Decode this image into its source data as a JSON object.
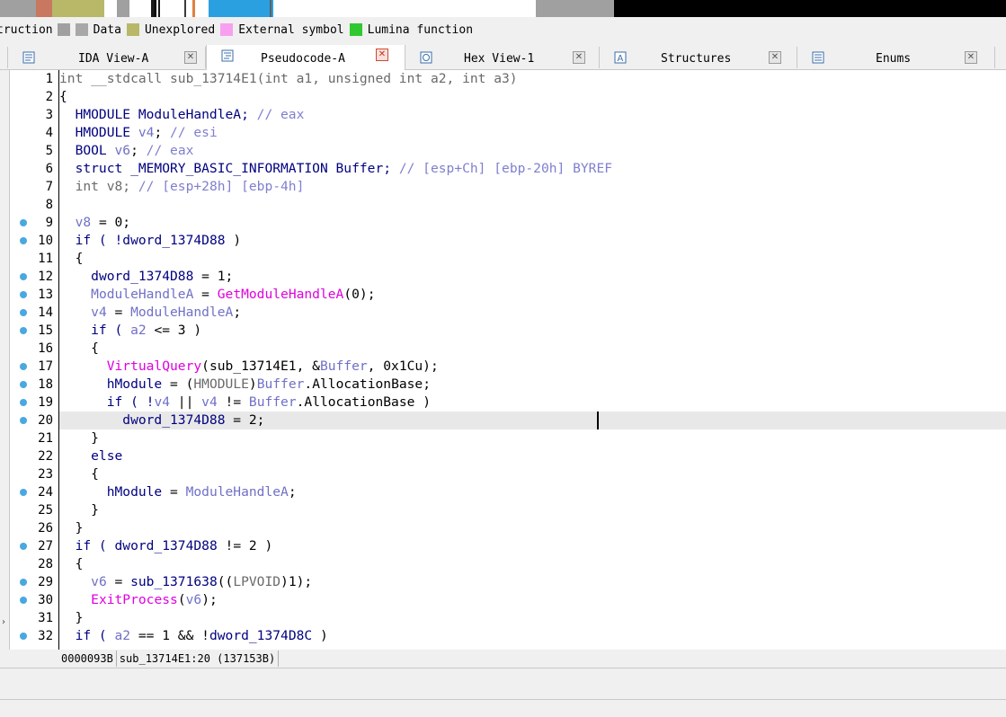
{
  "navband": {
    "segments": [
      {
        "color": "#a0a0a0"
      },
      {
        "color": "#c87860"
      },
      {
        "color": "#b8b868"
      },
      {
        "color": "#a0a0a0"
      },
      {
        "color": "#1a1a1a"
      },
      {
        "color": "#2aa0e0"
      },
      {
        "color": "#a0a0a0"
      },
      {
        "color": "#000000"
      }
    ]
  },
  "legend": [
    {
      "label": "truction",
      "color": "#a0a0a0"
    },
    {
      "label": "Data",
      "color": "#a8a8a8"
    },
    {
      "label": "Unexplored",
      "color": "#b8b868"
    },
    {
      "label": "External symbol",
      "color": "#f8a0f0"
    },
    {
      "label": "Lumina function",
      "color": "#30c830"
    }
  ],
  "tabs": [
    {
      "label": "IDA View-A",
      "icon": "ida-view-icon",
      "active": false
    },
    {
      "label": "Pseudocode-A",
      "icon": "pseudocode-icon",
      "active": true
    },
    {
      "label": "Hex View-1",
      "icon": "hex-view-icon",
      "active": false
    },
    {
      "label": "Structures",
      "icon": "structures-icon",
      "active": false
    },
    {
      "label": "Enums",
      "icon": "enums-icon",
      "active": false
    }
  ],
  "code": {
    "lines": [
      {
        "n": "1",
        "bp": false,
        "parts": [
          [
            "int __stdcall sub_13714E1(int a1, unsigned int a2, int a3)",
            "dim"
          ]
        ]
      },
      {
        "n": "2",
        "bp": false,
        "parts": [
          [
            "{",
            ""
          ]
        ]
      },
      {
        "n": "3",
        "bp": false,
        "parts": [
          [
            "  HMODULE ModuleHandleA; ",
            "kw"
          ],
          [
            "// eax",
            "cmt"
          ]
        ]
      },
      {
        "n": "4",
        "bp": false,
        "parts": [
          [
            "  HMODULE ",
            "kw"
          ],
          [
            "v4",
            "loc"
          ],
          [
            "; ",
            ""
          ],
          [
            "// esi",
            "cmt"
          ]
        ]
      },
      {
        "n": "5",
        "bp": false,
        "parts": [
          [
            "  BOOL ",
            "kw"
          ],
          [
            "v6",
            "loc"
          ],
          [
            "; ",
            ""
          ],
          [
            "// eax",
            "cmt"
          ]
        ]
      },
      {
        "n": "6",
        "bp": false,
        "parts": [
          [
            "  struct _MEMORY_BASIC_INFORMATION Buffer; ",
            "kw"
          ],
          [
            "// [esp+Ch] [ebp-20h] BYREF",
            "cmt"
          ]
        ]
      },
      {
        "n": "7",
        "bp": false,
        "parts": [
          [
            "  int v8; ",
            "dim"
          ],
          [
            "// [esp+28h] [ebp-4h]",
            "cmt"
          ]
        ]
      },
      {
        "n": "8",
        "bp": false,
        "parts": [
          [
            "",
            ""
          ]
        ]
      },
      {
        "n": "9",
        "bp": true,
        "parts": [
          [
            "  ",
            ""
          ],
          [
            "v8",
            "loc"
          ],
          [
            " = 0;",
            ""
          ]
        ]
      },
      {
        "n": "10",
        "bp": true,
        "parts": [
          [
            "  if ( !",
            "kw"
          ],
          [
            "dword_1374D88",
            "var"
          ],
          [
            " )",
            ""
          ]
        ]
      },
      {
        "n": "11",
        "bp": false,
        "parts": [
          [
            "  {",
            ""
          ]
        ]
      },
      {
        "n": "12",
        "bp": true,
        "parts": [
          [
            "    ",
            ""
          ],
          [
            "dword_1374D88",
            "var"
          ],
          [
            " = 1;",
            ""
          ]
        ]
      },
      {
        "n": "13",
        "bp": true,
        "parts": [
          [
            "    ",
            ""
          ],
          [
            "ModuleHandleA",
            "loc"
          ],
          [
            " = ",
            ""
          ],
          [
            "GetModuleHandleA",
            "fn"
          ],
          [
            "(0);",
            ""
          ]
        ]
      },
      {
        "n": "14",
        "bp": true,
        "parts": [
          [
            "    ",
            ""
          ],
          [
            "v4",
            "loc"
          ],
          [
            " = ",
            ""
          ],
          [
            "ModuleHandleA",
            "loc"
          ],
          [
            ";",
            ""
          ]
        ]
      },
      {
        "n": "15",
        "bp": true,
        "parts": [
          [
            "    if ( ",
            "kw"
          ],
          [
            "a2",
            "loc"
          ],
          [
            " <= 3 )",
            ""
          ]
        ]
      },
      {
        "n": "16",
        "bp": false,
        "parts": [
          [
            "    {",
            ""
          ]
        ]
      },
      {
        "n": "17",
        "bp": true,
        "parts": [
          [
            "      ",
            ""
          ],
          [
            "VirtualQuery",
            "fn"
          ],
          [
            "(sub_13714E1, &",
            ""
          ],
          [
            "Buffer",
            "loc"
          ],
          [
            ", 0x1Cu);",
            ""
          ]
        ]
      },
      {
        "n": "18",
        "bp": true,
        "parts": [
          [
            "      hModule",
            "var"
          ],
          [
            " = (",
            ""
          ],
          [
            "HMODULE",
            "dim"
          ],
          [
            ")",
            ""
          ],
          [
            "Buffer",
            "loc"
          ],
          [
            ".AllocationBase;",
            ""
          ]
        ]
      },
      {
        "n": "19",
        "bp": true,
        "parts": [
          [
            "      if ( !",
            "kw"
          ],
          [
            "v4",
            "loc"
          ],
          [
            " || ",
            ""
          ],
          [
            "v4",
            "loc"
          ],
          [
            " != ",
            ""
          ],
          [
            "Buffer",
            "loc"
          ],
          [
            ".AllocationBase )",
            ""
          ]
        ]
      },
      {
        "n": "20",
        "bp": true,
        "hl": true,
        "parts": [
          [
            "        dword_1374D88",
            "var"
          ],
          [
            " = 2;",
            ""
          ]
        ]
      },
      {
        "n": "21",
        "bp": false,
        "parts": [
          [
            "    }",
            ""
          ]
        ]
      },
      {
        "n": "22",
        "bp": false,
        "parts": [
          [
            "    else",
            "kw"
          ]
        ]
      },
      {
        "n": "23",
        "bp": false,
        "parts": [
          [
            "    {",
            ""
          ]
        ]
      },
      {
        "n": "24",
        "bp": true,
        "parts": [
          [
            "      hModule",
            "var"
          ],
          [
            " = ",
            ""
          ],
          [
            "ModuleHandleA",
            "loc"
          ],
          [
            ";",
            ""
          ]
        ]
      },
      {
        "n": "25",
        "bp": false,
        "parts": [
          [
            "    }",
            ""
          ]
        ]
      },
      {
        "n": "26",
        "bp": false,
        "parts": [
          [
            "  }",
            ""
          ]
        ]
      },
      {
        "n": "27",
        "bp": true,
        "parts": [
          [
            "  if ( ",
            "kw"
          ],
          [
            "dword_1374D88",
            "var"
          ],
          [
            " != 2 )",
            ""
          ]
        ]
      },
      {
        "n": "28",
        "bp": false,
        "parts": [
          [
            "  {",
            ""
          ]
        ]
      },
      {
        "n": "29",
        "bp": true,
        "parts": [
          [
            "    ",
            ""
          ],
          [
            "v6",
            "loc"
          ],
          [
            " = ",
            ""
          ],
          [
            "sub_1371638",
            "var"
          ],
          [
            "((",
            ""
          ],
          [
            "LPVOID",
            "dim"
          ],
          [
            ")1);",
            ""
          ]
        ]
      },
      {
        "n": "30",
        "bp": true,
        "parts": [
          [
            "    ",
            ""
          ],
          [
            "ExitProcess",
            "fn"
          ],
          [
            "(",
            ""
          ],
          [
            "v6",
            "loc"
          ],
          [
            ");",
            ""
          ]
        ]
      },
      {
        "n": "31",
        "bp": false,
        "parts": [
          [
            "  }",
            ""
          ]
        ]
      },
      {
        "n": "32",
        "bp": true,
        "parts": [
          [
            "  if ( ",
            "kw"
          ],
          [
            "a2",
            "loc"
          ],
          [
            " == 1 && !",
            ""
          ],
          [
            "dword_1374D8C",
            "var"
          ],
          [
            " )",
            ""
          ]
        ]
      }
    ]
  },
  "status": {
    "offset": "0000093B",
    "location": "sub_13714E1:20 (137153B)"
  }
}
